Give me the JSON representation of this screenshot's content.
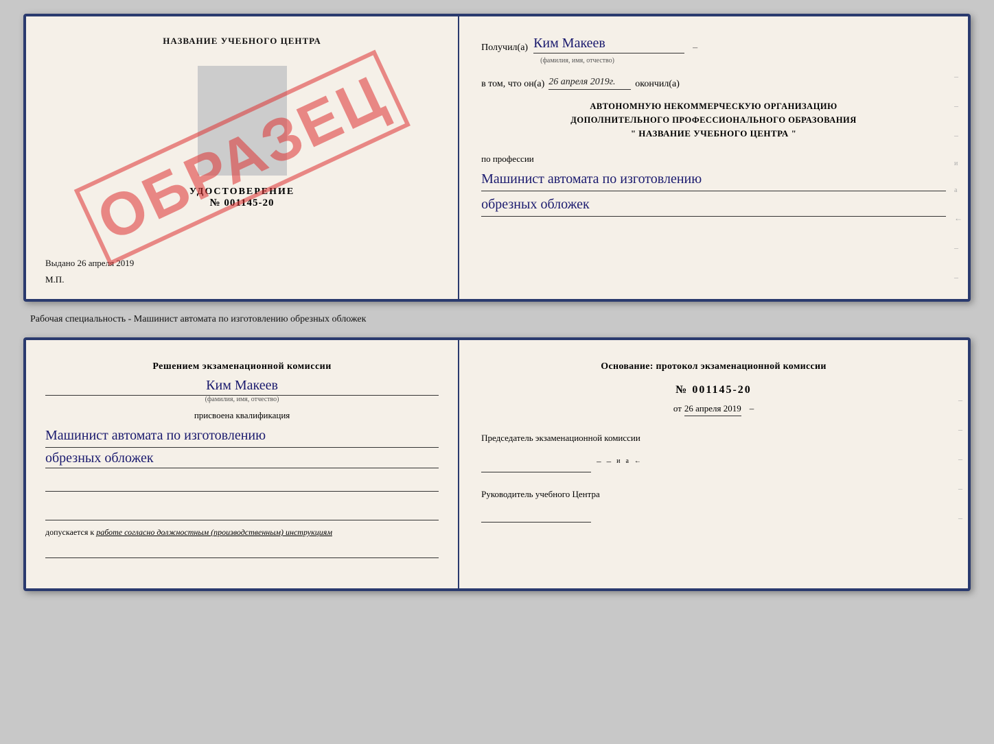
{
  "top_card": {
    "left": {
      "center_name": "НАЗВАНИЕ УЧЕБНОГО ЦЕНТРА",
      "udostoverenie_label": "УДОСТОВЕРЕНИЕ",
      "number": "№ 001145-20",
      "vydano_label": "Выдано",
      "vydano_date": "26 апреля 2019",
      "mp_label": "М.П.",
      "obrazec": "ОБРАЗЕЦ"
    },
    "right": {
      "poluchil_label": "Получил(а)",
      "poluchil_name": "Ким Макеев",
      "fio_sub": "(фамилия, имя, отчество)",
      "dash": "–",
      "vtom_prefix": "в том, что он(а)",
      "vtom_date": "26 апреля 2019г.",
      "okonchil": "окончил(а)",
      "org_line1": "АВТОНОМНУЮ НЕКОММЕРЧЕСКУЮ ОРГАНИЗАЦИЮ",
      "org_line2": "ДОПОЛНИТЕЛЬНОГО ПРОФЕССИОНАЛЬНОГО ОБРАЗОВАНИЯ",
      "org_name": "\" НАЗВАНИЕ УЧЕБНОГО ЦЕНТРА \"",
      "po_professii": "по профессии",
      "profession_line1": "Машинист автомата по изготовлению",
      "profession_line2": "обрезных обложек"
    }
  },
  "between": {
    "text": "Рабочая специальность - Машинист автомата по изготовлению обрезных обложек"
  },
  "bottom_card": {
    "left": {
      "resheniem_title": "Решением экзаменационной комиссии",
      "name_hw": "Ким Макеев",
      "fio_sub": "(фамилия, имя, отчество)",
      "prisvoena": "присвоена квалификация",
      "kvalif_line1": "Машинист автомата по изготовлению",
      "kvalif_line2": "обрезных обложек",
      "dopuskaetsya": "допускается к",
      "dopusk_italic": "работе согласно должностным (производственным) инструкциям"
    },
    "right": {
      "osnovanie": "Основание: протокол экзаменационной комиссии",
      "number": "№ 001145-20",
      "ot_prefix": "от",
      "ot_date": "26 апреля 2019",
      "predsedatel_label": "Председатель экзаменационной комиссии",
      "rukovoditel_label": "Руководитель учебного Центра"
    }
  }
}
